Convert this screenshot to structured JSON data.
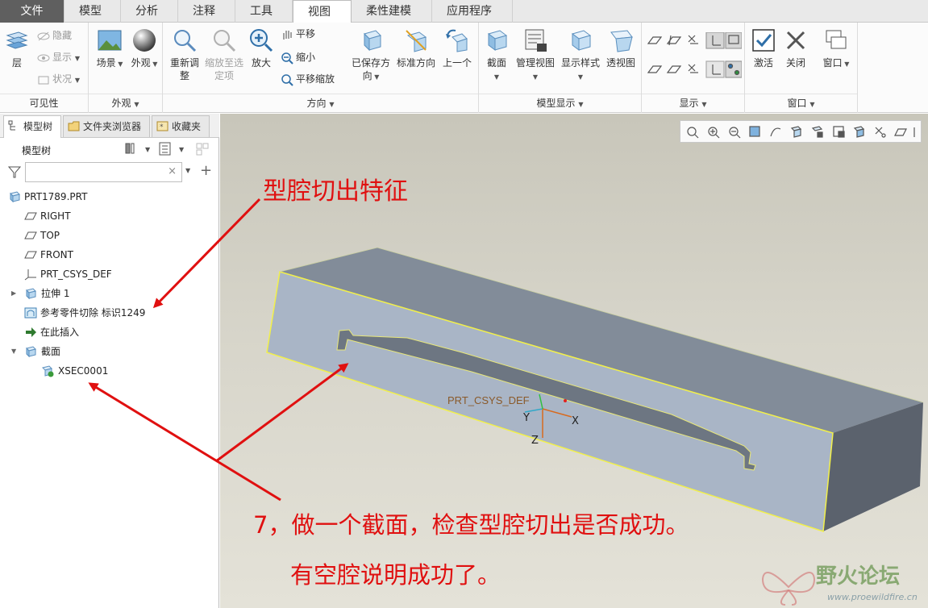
{
  "menu": {
    "tabs": [
      "文件",
      "模型",
      "分析",
      "注释",
      "工具",
      "视图",
      "柔性建模",
      "应用程序"
    ],
    "active": "视图"
  },
  "ribbon": {
    "visibility": {
      "layer": "层",
      "hide": "隐藏",
      "show": "显示",
      "status": "状况",
      "label": "可见性"
    },
    "appearance": {
      "scene": "场景",
      "appearance": "外观",
      "label": "外观"
    },
    "orientation": {
      "refit_line1": "重新调",
      "refit_line2": "整",
      "zoom_sel_line1": "缩放至选",
      "zoom_sel_line2": "定项",
      "zoom_in": "放大",
      "pan": "平移",
      "zoom_out": "缩小",
      "pan_zoom": "平移缩放",
      "saved_line1": "已保存方",
      "saved_line2": "向",
      "standard": "标准方向",
      "previous": "上一个",
      "label": "方向"
    },
    "model_display": {
      "section": "截面",
      "manage_views": "管理视图",
      "display_style": "显示样式",
      "perspective": "透视图",
      "label": "模型显示"
    },
    "show": {
      "label": "显示"
    },
    "window": {
      "activate": "激活",
      "close": "关闭",
      "windows": "窗口",
      "label": "窗口"
    }
  },
  "panel": {
    "tabs": [
      "模型树",
      "文件夹浏览器",
      "收藏夹"
    ],
    "title": "模型树",
    "filter_placeholder": ""
  },
  "tree": [
    {
      "label": "PRT1789.PRT",
      "icon": "part-icon"
    },
    {
      "label": "RIGHT",
      "icon": "datum-plane-icon"
    },
    {
      "label": "TOP",
      "icon": "datum-plane-icon"
    },
    {
      "label": "FRONT",
      "icon": "datum-plane-icon"
    },
    {
      "label": "PRT_CSYS_DEF",
      "icon": "csys-icon"
    },
    {
      "label": "拉伸 1",
      "icon": "extrude-icon",
      "expand": "▶"
    },
    {
      "label": "参考零件切除 标识1249",
      "icon": "cutout-icon"
    },
    {
      "label": "在此插入",
      "icon": "insert-arrow-icon"
    },
    {
      "label": "截面",
      "icon": "section-folder-icon",
      "expand": "▼"
    },
    {
      "label": "XSEC0001",
      "icon": "xsec-icon"
    }
  ],
  "viewport": {
    "csys_label": "PRT_CSYS_DEF",
    "axis_x": "X",
    "axis_y": "Y",
    "axis_z": "Z"
  },
  "annotations": {
    "cavity_cut": "型腔切出特征",
    "step_line1": "7，做一个截面，检查型腔切出是否成功。",
    "step_line2": "有空腔说明成功了。"
  },
  "watermark": {
    "text": "野火论坛",
    "url": "www.proewildfire.cn"
  },
  "colors": {
    "annotation_red": "#e01010",
    "model_edge": "#f2f04a",
    "menu_dark": "#5f5f5f"
  }
}
